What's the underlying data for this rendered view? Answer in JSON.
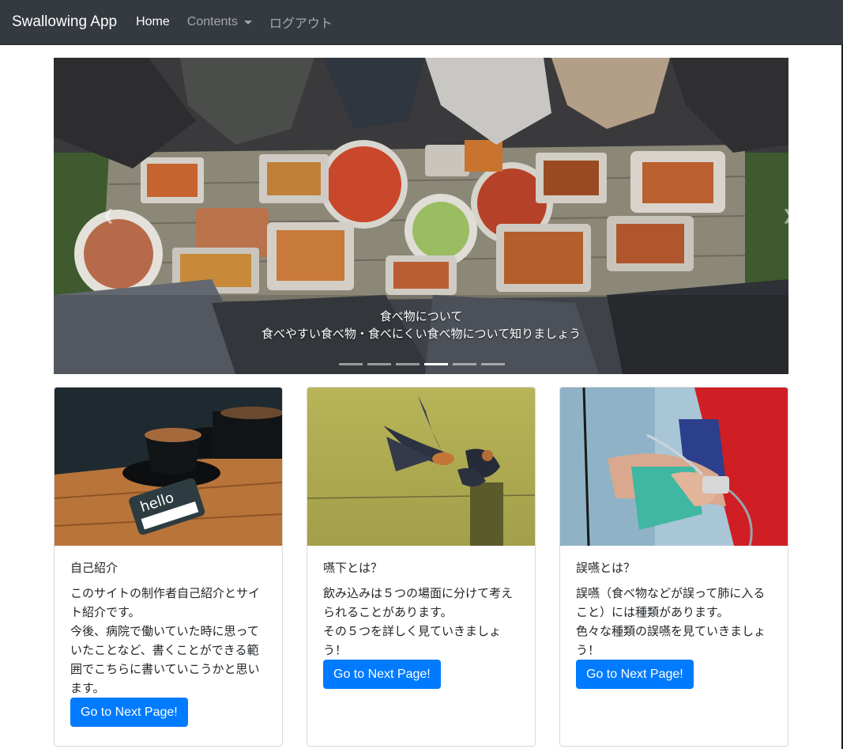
{
  "navbar": {
    "brand": "Swallowing App",
    "items": [
      {
        "label": "Home",
        "active": true
      },
      {
        "label": "Contents",
        "dropdown": true
      },
      {
        "label": "ログアウト"
      }
    ]
  },
  "carousel": {
    "caption_title": "食べ物について",
    "caption_text": "食べやすい食べ物・食べにくい食べ物について知りましょう",
    "slide_count": 6,
    "active_index": 3
  },
  "cards": [
    {
      "title": "自己紹介",
      "text": "このサイトの制作者自己紹介とサイト紹介です。\n今後、病院で働いていた時に思っていたことなど、書くことができる範囲でこちらに書いていこうかと思います。",
      "button": "Go to Next Page!"
    },
    {
      "title": "嚥下とは？",
      "text": "飲み込みは５つの場面に分けて考えられることがあります。\nその５つを詳しく見ていきましょう！",
      "button": "Go to Next Page!"
    },
    {
      "title": "誤嚥とは？",
      "text": "誤嚥（食べ物などが誤って肺に入ること）には種類があります。\n色々な種類の誤嚥を見ていきましょう！",
      "button": "Go to Next Page!"
    }
  ],
  "colors": {
    "navbar_bg": "#343a40",
    "primary": "#007bff"
  }
}
